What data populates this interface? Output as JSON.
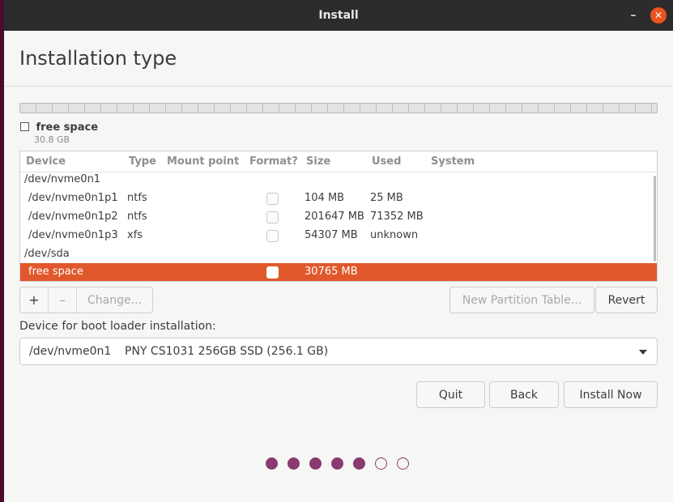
{
  "window": {
    "title": "Install",
    "minimize_glyph": "–",
    "close_glyph": "✕"
  },
  "page": {
    "title": "Installation type"
  },
  "legend": {
    "label": "free space",
    "size": "30.8 GB"
  },
  "table": {
    "headers": [
      "Device",
      "Type",
      "Mount point",
      "Format?",
      "Size",
      "Used",
      "System"
    ],
    "rows": [
      {
        "device": "/dev/nvme0n1",
        "type": "",
        "size": "",
        "used": "",
        "checkbox": false,
        "is_group": true
      },
      {
        "device": "/dev/nvme0n1p1",
        "type": "ntfs",
        "size": "104 MB",
        "used": "25 MB",
        "checkbox": true
      },
      {
        "device": "/dev/nvme0n1p2",
        "type": "ntfs",
        "size": "201647 MB",
        "used": "71352 MB",
        "checkbox": true
      },
      {
        "device": "/dev/nvme0n1p3",
        "type": "xfs",
        "size": "54307 MB",
        "used": "unknown",
        "checkbox": true
      },
      {
        "device": "/dev/sda",
        "type": "",
        "size": "",
        "used": "",
        "checkbox": false,
        "is_group": true
      },
      {
        "device": "free space",
        "type": "",
        "size": "30765 MB",
        "used": "",
        "checkbox": true,
        "selected": true
      }
    ]
  },
  "partition_buttons": {
    "add": "+",
    "remove": "–",
    "change": "Change..."
  },
  "new_partition_table": "New Partition Table...",
  "revert": "Revert",
  "boot_loader": {
    "label": "Device for boot loader installation:",
    "device": "/dev/nvme0n1",
    "description": "PNY CS1031 256GB SSD (256.1 GB)"
  },
  "actions": {
    "quit": "Quit",
    "back": "Back",
    "install_now": "Install Now"
  },
  "progress": {
    "steps_total": 7,
    "steps_done": 5
  },
  "colors": {
    "accent": "#e95420",
    "selection": "#e0582b",
    "progress_dot": "#8a3a6e"
  }
}
